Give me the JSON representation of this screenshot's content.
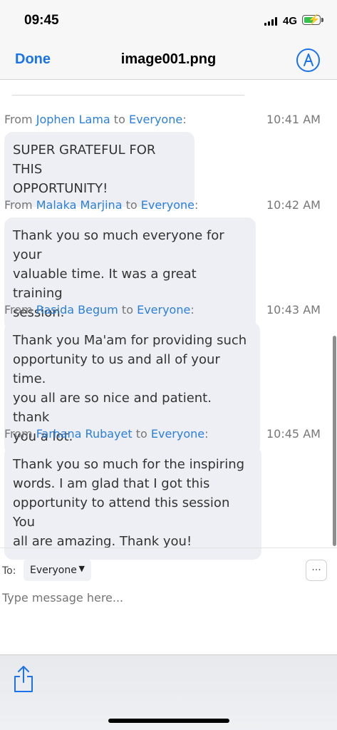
{
  "status_bar": {
    "time": "09:45",
    "network": "4G",
    "battery_color": "#33c24d",
    "battery_level": 0.65
  },
  "nav": {
    "done_label": "Done",
    "title": "image001.png",
    "markup_icon": "markup-pen-icon",
    "accent_color": "#1a73e8"
  },
  "messages": [
    {
      "prefix": "From ",
      "sender": "Jophen Lama",
      "connector": " to ",
      "recipient": "Everyone",
      "suffix": ":",
      "time": "10:41 AM",
      "lines": [
        "SUPER GRATEFUL FOR THIS",
        "OPPORTUNITY!"
      ]
    },
    {
      "prefix": "From ",
      "sender": "Malaka Marjina",
      "connector": " to ",
      "recipient": "Everyone",
      "suffix": ":",
      "time": "10:42 AM",
      "lines": [
        "Thank you so much everyone for your",
        "valuable time. It was a great training",
        "session."
      ]
    },
    {
      "prefix": "From ",
      "sender": "Rasida Begum",
      "connector": " to ",
      "recipient": "Everyone",
      "suffix": ":",
      "time": "10:43 AM",
      "lines": [
        "Thank you Ma'am for providing such",
        "opportunity to us and all of your time.",
        "you all are so nice and patient. thank",
        "you a lot."
      ]
    },
    {
      "prefix": "From ",
      "sender": "Farhana Rubayet",
      "connector": " to ",
      "recipient": "Everyone",
      "suffix": ":",
      "time": "10:45 AM",
      "lines": [
        "Thank you so much for the inspiring",
        "words. I am glad that I got this",
        "opportunity to attend this session You",
        "all are amazing. Thank you!"
      ]
    }
  ],
  "compose": {
    "to_label": "To:",
    "to_value": "Everyone",
    "more_label": "···",
    "placeholder": "Type message here..."
  },
  "toolbar": {
    "share_icon": "share-icon"
  }
}
